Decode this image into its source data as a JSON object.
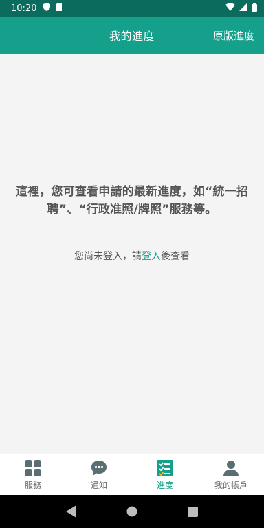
{
  "status_bar": {
    "time": "10:20"
  },
  "app_bar": {
    "title": "我的進度",
    "action_label": "原版進度"
  },
  "content": {
    "description_line1": "這裡，您可查看申請的最新進度，如“統一招",
    "description_line2": "聘”、“行政准照/牌照”服務等。",
    "login_prefix": "您尚未登入，請",
    "login_link": "登入",
    "login_suffix": "後查看"
  },
  "bottom_nav": {
    "items": [
      {
        "label": "服務",
        "icon": "grid-icon"
      },
      {
        "label": "通知",
        "icon": "chat-bubble-icon"
      },
      {
        "label": "進度",
        "icon": "checklist-icon",
        "active": true
      },
      {
        "label": "我的帳戶",
        "icon": "user-icon"
      }
    ]
  },
  "colors": {
    "primary": "#14a08a",
    "status_bar": "#0b6b5c",
    "icon_gray": "#5a6d73"
  }
}
